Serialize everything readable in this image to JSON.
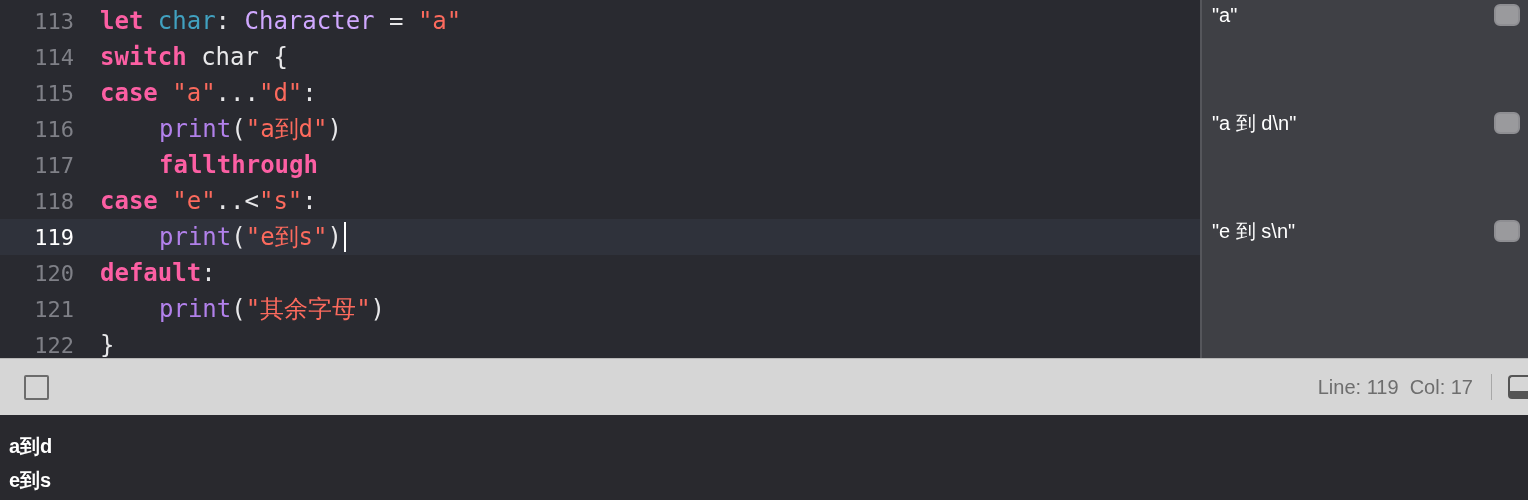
{
  "editor": {
    "lines": [
      {
        "number": "113",
        "current": false,
        "indent": false,
        "tokens": [
          {
            "kind": "keyword",
            "text": "let"
          },
          {
            "kind": "variable",
            "text": " char"
          },
          {
            "kind": "plain",
            "text": ": "
          },
          {
            "kind": "type",
            "text": "Character"
          },
          {
            "kind": "plain",
            "text": " = "
          },
          {
            "kind": "string",
            "text": "\"a\""
          }
        ],
        "result": "\"a\""
      },
      {
        "number": "114",
        "current": false,
        "indent": false,
        "tokens": [
          {
            "kind": "keyword",
            "text": "switch"
          },
          {
            "kind": "plain",
            "text": " char {"
          }
        ]
      },
      {
        "number": "115",
        "current": false,
        "indent": false,
        "tokens": [
          {
            "kind": "keyword",
            "text": "case"
          },
          {
            "kind": "string",
            "text": " \"a\""
          },
          {
            "kind": "plain",
            "text": "..."
          },
          {
            "kind": "string",
            "text": "\"d\""
          },
          {
            "kind": "plain",
            "text": ":"
          }
        ]
      },
      {
        "number": "116",
        "current": false,
        "indent": true,
        "tokens": [
          {
            "kind": "function",
            "text": "print"
          },
          {
            "kind": "plain",
            "text": "("
          },
          {
            "kind": "string",
            "text": "\"a到d\""
          },
          {
            "kind": "plain",
            "text": ")"
          }
        ],
        "result": "\"a 到 d\\n\""
      },
      {
        "number": "117",
        "current": false,
        "indent": true,
        "tokens": [
          {
            "kind": "keyword",
            "text": "fallthrough"
          }
        ]
      },
      {
        "number": "118",
        "current": false,
        "indent": false,
        "tokens": [
          {
            "kind": "keyword",
            "text": "case"
          },
          {
            "kind": "string",
            "text": " \"e\""
          },
          {
            "kind": "plain",
            "text": "..<"
          },
          {
            "kind": "string",
            "text": "\"s\""
          },
          {
            "kind": "plain",
            "text": ":"
          }
        ]
      },
      {
        "number": "119",
        "current": true,
        "indent": true,
        "tokens": [
          {
            "kind": "function",
            "text": "print"
          },
          {
            "kind": "plain",
            "text": "("
          },
          {
            "kind": "string",
            "text": "\"e到s\""
          },
          {
            "kind": "plain",
            "text": ")"
          }
        ],
        "result": "\"e 到 s\\n\""
      },
      {
        "number": "120",
        "current": false,
        "indent": false,
        "tokens": [
          {
            "kind": "keyword",
            "text": "default"
          },
          {
            "kind": "plain",
            "text": ":"
          }
        ]
      },
      {
        "number": "121",
        "current": false,
        "indent": true,
        "tokens": [
          {
            "kind": "function",
            "text": "print"
          },
          {
            "kind": "plain",
            "text": "("
          },
          {
            "kind": "string",
            "text": "\"其余字母\""
          },
          {
            "kind": "plain",
            "text": ")"
          }
        ]
      },
      {
        "number": "122",
        "current": false,
        "indent": false,
        "tokens": [
          {
            "kind": "plain",
            "text": "}"
          }
        ]
      }
    ]
  },
  "status_bar": {
    "position": "Line: 119  Col: 17"
  },
  "console": {
    "lines": [
      "a到d",
      "e到s"
    ]
  }
}
